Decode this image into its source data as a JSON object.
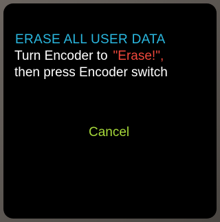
{
  "screen": {
    "title": "ERASE ALL USER DATA",
    "instruction_prefix": "Turn Encoder to",
    "erase_option": "\"Erase!\",",
    "instruction_line2": "then press Encoder switch",
    "cancel_option": "Cancel"
  },
  "colors": {
    "background": "#000000",
    "title": "#2ab8e0",
    "text": "#ffffff",
    "erase_option": "#f0483c",
    "cancel_option": "#a6d83a"
  }
}
